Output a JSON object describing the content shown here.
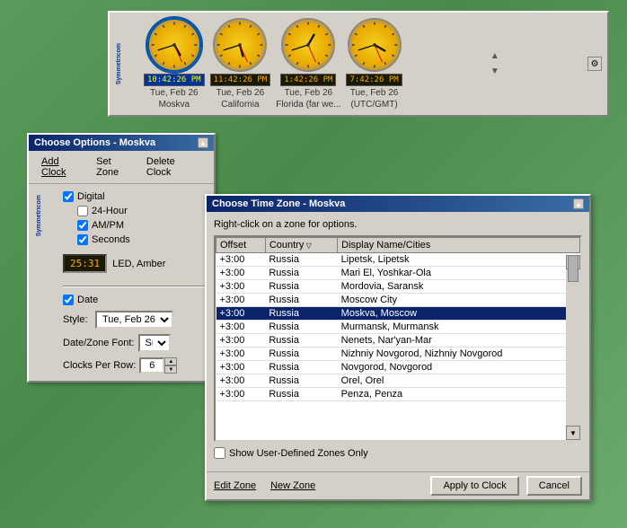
{
  "clockBar": {
    "clocks": [
      {
        "id": "moskva",
        "display": "10:42:26 PM",
        "date": "Tue, Feb 26",
        "label": "Moskva",
        "selected": true,
        "hourAngle": 150,
        "minuteAngle": 252,
        "secondAngle": 156
      },
      {
        "id": "california",
        "display": "11:42:26 PM",
        "date": "Tue, Feb 26",
        "label": "California",
        "selected": false,
        "hourAngle": 165,
        "minuteAngle": 252,
        "secondAngle": 156
      },
      {
        "id": "florida",
        "display": "1:42:26 PM",
        "date": "Tue, Feb 26",
        "label": "Florida (far we...",
        "selected": false,
        "hourAngle": 30,
        "minuteAngle": 252,
        "secondAngle": 156
      },
      {
        "id": "utcgmt",
        "display": "7:42:26 PM",
        "date": "Tue, Feb 26",
        "label": "(UTC/GMT)",
        "selected": false,
        "hourAngle": 120,
        "minuteAngle": 252,
        "secondAngle": 156
      }
    ],
    "logoText": "Symmetricom"
  },
  "optionsDialog": {
    "title": "Choose Options - Moskva",
    "menuItems": [
      "Add Clock",
      "Set Zone",
      "Delete Clock"
    ],
    "checks": {
      "digital": true,
      "hour24": false,
      "ampm": true,
      "seconds": true,
      "date": true
    },
    "ledPreview": "25:31",
    "ledLabel": "LED, Amber",
    "styleLabel": "Style:",
    "styleValue": "Tue, Feb 26",
    "dateZoneFontLabel": "Date/Zone Font:",
    "dateZoneFontValue": "Sm",
    "clocksPerRowLabel": "Clocks Per Row:",
    "clocksPerRowValue": "6",
    "logoText": "Symmetricom"
  },
  "timezoneDialog": {
    "title": "Choose Time Zone - Moskva",
    "instruction": "Right-click on a zone for options.",
    "columns": [
      "Offset",
      "Country",
      "Display Name/Cities"
    ],
    "sortedColumn": "Country",
    "rows": [
      {
        "offset": "+3:00",
        "country": "Russia",
        "display": "Lipetsk, Lipetsk",
        "selected": false
      },
      {
        "offset": "+3:00",
        "country": "Russia",
        "display": "Mari El, Yoshkar-Ola",
        "selected": false
      },
      {
        "offset": "+3:00",
        "country": "Russia",
        "display": "Mordovia, Saransk",
        "selected": false
      },
      {
        "offset": "+3:00",
        "country": "Russia",
        "display": "Moscow City",
        "selected": false
      },
      {
        "offset": "+3:00",
        "country": "Russia",
        "display": "Moskva, Moscow",
        "selected": true
      },
      {
        "offset": "+3:00",
        "country": "Russia",
        "display": "Murmansk, Murmansk",
        "selected": false
      },
      {
        "offset": "+3:00",
        "country": "Russia",
        "display": "Nenets, Nar'yan-Mar",
        "selected": false
      },
      {
        "offset": "+3:00",
        "country": "Russia",
        "display": "Nizhniy Novgorod, Nizhniy Novgorod",
        "selected": false
      },
      {
        "offset": "+3:00",
        "country": "Russia",
        "display": "Novgorod, Novgorod",
        "selected": false
      },
      {
        "offset": "+3:00",
        "country": "Russia",
        "display": "Orel, Orel",
        "selected": false
      },
      {
        "offset": "+3:00",
        "country": "Russia",
        "display": "Penza, Penza",
        "selected": false
      }
    ],
    "showUserDefined": false,
    "showUserDefinedLabel": "Show User-Defined Zones Only",
    "footerLinks": [
      "Edit Zone",
      "New Zone"
    ],
    "footerButtons": [
      "Apply to Clock",
      "Cancel"
    ]
  }
}
